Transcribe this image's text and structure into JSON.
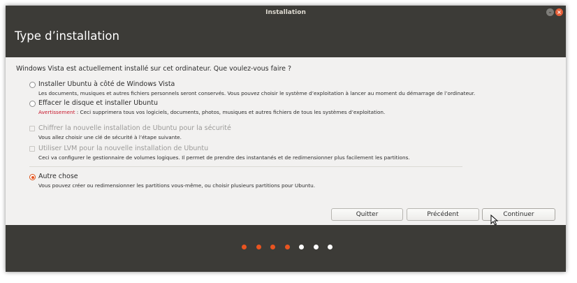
{
  "window": {
    "title": "Installation",
    "minimize_glyph": "–",
    "close_glyph": "×"
  },
  "header": {
    "title": "Type d’installation"
  },
  "question": "Windows Vista est actuellement installé sur cet ordinateur. Que voulez-vous faire ?",
  "options": [
    {
      "label": "Installer Ubuntu à côté de Windows Vista",
      "desc": "Les documents, musiques et autres fichiers personnels seront conservés. Vous pouvez choisir le système d’exploitation à lancer au moment du démarrage de l’ordinateur.",
      "control": "radio",
      "checked": false,
      "enabled": true
    },
    {
      "label": "Effacer le disque et installer Ubuntu",
      "warning_label": "Avertissement",
      "desc": " : Ceci supprimera tous vos logiciels, documents, photos, musiques et autres fichiers de tous les systèmes d’exploitation.",
      "control": "radio",
      "checked": false,
      "enabled": true
    },
    {
      "label": "Chiffrer la nouvelle installation de Ubuntu pour la sécurité",
      "desc": "Vous allez choisir une clé de sécurité à l’étape suivante.",
      "control": "checkbox",
      "checked": false,
      "enabled": false
    },
    {
      "label": "Utiliser LVM pour la nouvelle installation de Ubuntu",
      "desc": "Ceci va configurer le gestionnaire de volumes logiques. Il permet de prendre des instantanés et de redimensionner plus facilement les partitions.",
      "control": "checkbox",
      "checked": false,
      "enabled": false
    },
    {
      "label": "Autre chose",
      "desc": "Vous pouvez créer ou redimensionner les partitions vous-même, ou choisir plusieurs partitions pour Ubuntu.",
      "control": "radio",
      "checked": true,
      "enabled": true
    }
  ],
  "buttons": {
    "quit": "Quitter",
    "back": "Précédent",
    "continue": "Continuer"
  },
  "progress": {
    "total_steps": 7,
    "completed_steps": 4,
    "active_color": "#e95420",
    "inactive_color": "#ffffff"
  },
  "colors": {
    "accent": "#e95420",
    "titlebar": "#3c3b37",
    "warning": "#c7162b"
  }
}
